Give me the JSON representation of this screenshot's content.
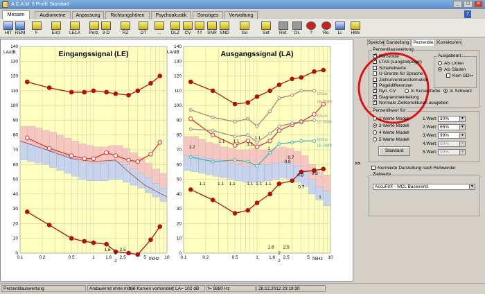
{
  "window": {
    "title": "A.C.A.M. 5  Profil: Standard",
    "buttons": [
      "_",
      "□",
      "✕"
    ]
  },
  "tabs": [
    "Messen",
    "Audiometrie",
    "Anpassung",
    "Richtungshören",
    "Psychoakustik",
    "Sonstiges",
    "Verwaltung"
  ],
  "help_tab_icon": "question-icon",
  "toolbar": [
    {
      "label": "HIT",
      "icon": "computer-icon"
    },
    {
      "label": "REM",
      "icon": "speaker-icon"
    },
    {
      "label": "F",
      "icon": "f-icon"
    },
    {
      "label": "Einz",
      "icon": "single-icon"
    },
    {
      "label": "LELA",
      "icon": "lela-icon"
    },
    {
      "label": "Perz.",
      "icon": "perz-icon"
    },
    {
      "label": "3-D",
      "icon": "3d-icon"
    },
    {
      "label": "RZ",
      "icon": "rz-icon"
    },
    {
      "label": "DT",
      "icon": "dt-icon"
    },
    {
      "label": "...",
      "icon": "more-icon"
    },
    {
      "label": "DLZ",
      "icon": "dlz-icon"
    },
    {
      "label": "CV",
      "icon": "cv-icon"
    },
    {
      "label": "f-f",
      "icon": "ff-icon"
    },
    {
      "label": "SNR",
      "icon": "snr-icon"
    },
    {
      "label": "SND",
      "icon": "snd-icon"
    },
    {
      "label": "Go",
      "icon": "go-icon"
    },
    {
      "label": "Set",
      "icon": "set-icon"
    },
    {
      "label": "Ref.",
      "icon": "glasses-icon"
    },
    {
      "label": "Dr.",
      "icon": "print-icon"
    },
    {
      "label": "?",
      "icon": "help-icon"
    },
    {
      "label": "Re.",
      "icon": "right-ear-icon"
    },
    {
      "label": "Li.",
      "icon": "left-ear-icon"
    },
    {
      "label": "Hilfe",
      "icon": "hilfe-icon"
    }
  ],
  "charts": {
    "left": {
      "title": "Eingangssignal (LE)",
      "yunit": "LA/dB",
      "xunit": "f/kHz"
    },
    "right": {
      "title": "Ausgangssignal (LA)",
      "yunit": "LA/dB",
      "xunit": "f/kHz"
    }
  },
  "chart_data": [
    {
      "type": "line",
      "title": "Eingangssignal (LE)",
      "ylabel": "LA/dB",
      "xlabel": "f/kHz",
      "xscale": "log",
      "ylim": [
        0,
        140
      ],
      "x_ticks": [
        "0.1",
        "0.2",
        "0.5",
        "1",
        "1.6",
        "2",
        "2.5",
        "5",
        "10"
      ],
      "y_ticks": [
        0,
        10,
        20,
        30,
        40,
        50,
        60,
        70,
        80,
        90,
        100,
        110,
        120,
        130,
        140
      ],
      "series": [
        {
          "role": "upper",
          "x": [
            0.125,
            0.25,
            0.5,
            0.75,
            1,
            1.5,
            2,
            3,
            4,
            6,
            8
          ],
          "values": [
            116,
            112,
            109,
            109,
            110,
            109,
            108,
            107,
            110,
            115,
            120
          ]
        },
        {
          "role": "middle",
          "x": [
            0.125,
            0.25,
            0.5,
            0.75,
            1,
            1.5,
            2,
            3,
            4,
            6,
            8
          ],
          "values": [
            78,
            71,
            66,
            64,
            64,
            68,
            66,
            63,
            62,
            67,
            75
          ]
        },
        {
          "role": "lower",
          "x": [
            0.125,
            0.25,
            0.5,
            0.75,
            1,
            1.5,
            2,
            3,
            4,
            6,
            8
          ],
          "values": [
            28,
            19,
            10,
            8,
            7,
            6,
            1,
            0,
            -1,
            9,
            18
          ]
        },
        {
          "role": "LTAS",
          "x": [
            0.1,
            0.2,
            0.5,
            1,
            2,
            3,
            5,
            10
          ],
          "values": [
            76,
            71,
            64,
            62,
            63,
            55,
            46,
            38
          ]
        }
      ],
      "annotations": [
        "1.6",
        "2",
        "2.5"
      ]
    },
    {
      "type": "line",
      "title": "Ausgangssignal (LA)",
      "ylabel": "LA/dB",
      "xlabel": "f/kHz",
      "xscale": "log",
      "ylim": [
        0,
        140
      ],
      "x_ticks": [
        "0.1",
        "0.2",
        "0.5",
        "1",
        "1.6",
        "2",
        "2.5",
        "5",
        "10"
      ],
      "y_ticks": [
        0,
        10,
        20,
        30,
        40,
        50,
        60,
        70,
        80,
        90,
        100,
        110,
        120,
        130,
        140
      ],
      "series": [
        {
          "role": "upper",
          "x": [
            0.125,
            0.25,
            0.5,
            0.75,
            1,
            1.5,
            2,
            3,
            4,
            6,
            8
          ],
          "values": [
            116,
            110,
            101,
            102,
            106,
            110,
            114,
            118,
            119,
            123,
            124
          ]
        },
        {
          "role": "middle",
          "x": [
            0.125,
            0.25,
            0.5,
            0.75,
            1,
            1.5,
            2,
            3,
            4,
            6,
            8
          ],
          "values": [
            91,
            80,
            73,
            76,
            72,
            76,
            83,
            87,
            89,
            94,
            101
          ]
        },
        {
          "role": "lower",
          "x": [
            0.125,
            0.25,
            0.5,
            0.75,
            1,
            1.5,
            2,
            3,
            4,
            6,
            8
          ],
          "values": [
            43,
            36,
            27,
            29,
            34,
            40,
            47,
            49,
            55,
            56,
            57
          ]
        },
        {
          "role": "DSLio",
          "x": [
            0.125,
            0.25,
            0.5,
            0.75,
            1,
            1.5,
            2,
            3,
            4,
            6
          ],
          "values": [
            97,
            92,
            89,
            91,
            86,
            96,
            105,
            107,
            110,
            110
          ]
        },
        {
          "role": "DSLio-65",
          "x": [
            0.125,
            0.25,
            0.5,
            0.75,
            1,
            1.5,
            2,
            3,
            4,
            6
          ],
          "values": [
            84,
            83,
            79,
            80,
            75,
            81,
            86,
            88,
            89,
            90
          ]
        },
        {
          "role": "DSLio-50",
          "x": [
            0.125,
            0.25,
            0.5,
            0.75,
            1,
            1.5,
            2,
            3,
            4,
            6
          ],
          "values": [
            65,
            62,
            63,
            62,
            59,
            68,
            74,
            75,
            76,
            76
          ]
        }
      ],
      "annotations": [
        "1.2",
        "1.1",
        "1.1",
        "1.1",
        "1.1",
        "1",
        "0.9",
        "0.7",
        "0.8",
        "0.7",
        "1",
        "1.1",
        "1.1",
        "1.1",
        "1.1",
        "1.1",
        "1.1",
        "0.8",
        "1.6",
        "2",
        "2.5"
      ],
      "curve_labels": [
        "DSLio",
        "LE 80dB",
        "DSLio",
        "LE 65dB",
        "DSLio",
        "LE 50dB"
      ]
    }
  ],
  "right_panel": {
    "tabs": [
      "Speicher",
      "Darstellung",
      "Perzentile",
      "Korrekturen"
    ],
    "active_tab": "Perzentile",
    "group_title": "Perzentilauswertung",
    "checks": [
      {
        "label": "Perzentile",
        "on": true
      },
      {
        "label": "LTAS (Langzeitpegel)",
        "on": true
      },
      {
        "label": "Scheitelwerte",
        "on": false
      },
      {
        "label": "U-Grenze für Sprache",
        "on": false
      },
      {
        "label": "Zielkurventransformation",
        "on": false
      },
      {
        "label": "Pegeldifferenzen",
        "on": false
      },
      {
        "label": "Dyn. CV",
        "on": true
      },
      {
        "label": "Diagrammeinteilung",
        "on": true
      },
      {
        "label": "Normale Zielkorrekturen ausgeben",
        "on": true
      }
    ],
    "color_radio": [
      {
        "label": "In Kurvenfarbe",
        "on": false
      },
      {
        "label": "In Schwarz",
        "on": true
      }
    ],
    "ausgabe_title": "Ausgabeart",
    "ausgabe": [
      {
        "label": "Als Linien",
        "on": false
      },
      {
        "label": "Als Säulen",
        "on": true
      }
    ],
    "kein_gdi": "Kein GDI+",
    "perz_title": "Perzentilwert für:",
    "models": [
      {
        "label": "2 Werte Modell",
        "on": false
      },
      {
        "label": "3 Werte Modell",
        "on": true
      },
      {
        "label": "4 Werte Modell",
        "on": false
      },
      {
        "label": "5 Werte Modell",
        "on": false
      }
    ],
    "werte": [
      {
        "label": "1.Wert:",
        "value": "30%",
        "dis": false
      },
      {
        "label": "2.Wert:",
        "value": "65%",
        "dis": false
      },
      {
        "label": "3.Wert:",
        "value": "99%",
        "dis": false
      },
      {
        "label": "4.Wert:",
        "value": "99%",
        "dis": true
      },
      {
        "label": "5.Wert:",
        "value": "99%",
        "dis": true
      }
    ],
    "standard": "Standard",
    "normiert": "Normierte Darstellung nach Rohwerder",
    "zielwerte_title": "Zielwerte",
    "zielwerte": "AccuFit® - MCL Basierend",
    "expander": ">>"
  },
  "status": [
    "Perzentilauswertung",
    "Andauernd ohne mitte",
    "6 Kurven vorhanden",
    "LA= 102 dB",
    "f= 9880 Hz",
    "28.12.2012 23:19:30"
  ]
}
